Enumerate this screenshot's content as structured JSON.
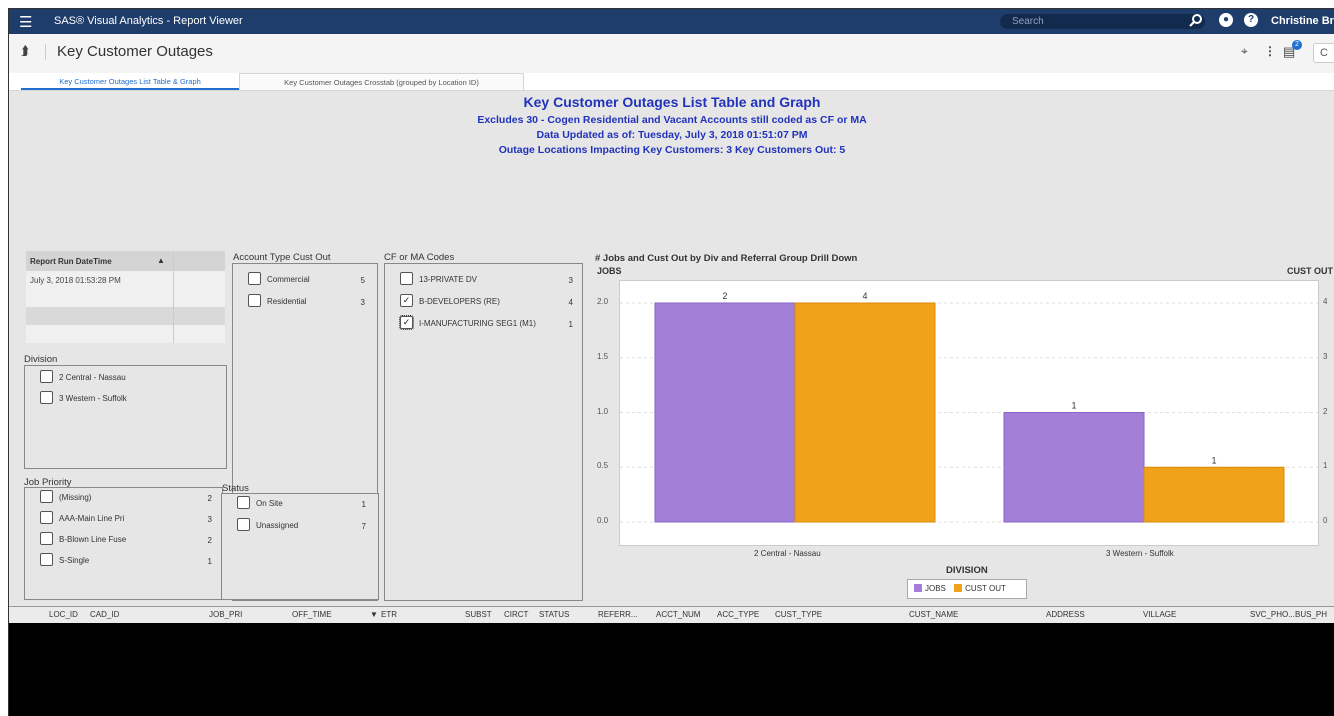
{
  "app": {
    "title": "SAS® Visual Analytics - Report Viewer",
    "search_placeholder": "Search",
    "user": "Christine Br"
  },
  "header": {
    "report_title": "Key Customer Outages",
    "badge": "2",
    "box_text": "C"
  },
  "tabs": [
    {
      "label": "Key Customer Outages List Table & Graph",
      "active": true
    },
    {
      "label": "Key Customer Outages Crosstab (grouped by Location ID)",
      "active": false
    }
  ],
  "report": {
    "title": "Key Customer Outages List Table and Graph",
    "line1": "Excludes 30 - Cogen Residential and Vacant Accounts still coded as CF or MA",
    "line2": "Data Updated as of: Tuesday, July 3, 2018 01:51:07 PM",
    "line3": "Outage Locations Impacting Key Customers:  3 Key Customers Out: 5"
  },
  "report_run": {
    "header": "Report Run DateTime",
    "value": "July 3, 2018 01:53:28 PM"
  },
  "division": {
    "label": "Division",
    "items": [
      {
        "label": "2 Central - Nassau"
      },
      {
        "label": "3 Western - Suffolk"
      }
    ]
  },
  "account_type": {
    "label": "Account Type Cust Out",
    "items": [
      {
        "label": "Commercial",
        "count": "5"
      },
      {
        "label": "Residential",
        "count": "3"
      }
    ]
  },
  "cf_ma": {
    "label": "CF or MA Codes",
    "items": [
      {
        "label": "13-PRIVATE DV",
        "count": "3",
        "checked": false
      },
      {
        "label": "B-DEVELOPERS (RE)",
        "count": "4",
        "checked": true
      },
      {
        "label": "I-MANUFACTURING SEG1 (M1)",
        "count": "1",
        "checked": true
      }
    ]
  },
  "job_priority": {
    "label": "Job Priority",
    "items": [
      {
        "label": "(Missing)",
        "count": "2"
      },
      {
        "label": "AAA-Main Line Pri",
        "count": "3"
      },
      {
        "label": "B-Blown Line Fuse",
        "count": "2"
      },
      {
        "label": "S-Single",
        "count": "1"
      }
    ]
  },
  "status": {
    "label": "Status",
    "items": [
      {
        "label": "On Site",
        "count": "1"
      },
      {
        "label": "Unassigned",
        "count": "7"
      }
    ]
  },
  "colors": {
    "jobs": "#a47fd8",
    "cust_out": "#f0a21b",
    "title_blue": "#2233bb",
    "topbar": "#1f3d6b"
  },
  "chart_data": {
    "type": "bar",
    "title": "# Jobs and Cust Out by Div and Referral Group Drill Down",
    "categories": [
      "2 Central - Nassau",
      "3 Western - Suffolk"
    ],
    "xlabel": "DIVISION",
    "ylabel": "JOBS",
    "y2label": "CUST OUT",
    "ylim": [
      0,
      2.0
    ],
    "y2lim": [
      0,
      4
    ],
    "yticks": [
      "0.0",
      "0.5",
      "1.0",
      "1.5",
      "2.0"
    ],
    "y2ticks": [
      "0",
      "1",
      "2",
      "3",
      "4"
    ],
    "series": [
      {
        "name": "JOBS",
        "axis": "left",
        "values": [
          2,
          1
        ],
        "labels": [
          "2",
          "1"
        ]
      },
      {
        "name": "CUST OUT",
        "axis": "right",
        "values": [
          4,
          1
        ],
        "labels": [
          "4",
          "1"
        ]
      }
    ],
    "legend": "bottom"
  },
  "table": {
    "columns": [
      "LOC_ID",
      "CAD_ID",
      "JOB_PRI",
      "OFF_TIME",
      "ETR",
      "SUBST",
      "CIRCT",
      "STATUS",
      "REFERR...",
      "ACCT_NUM",
      "ACC_TYPE",
      "CUST_TYPE",
      "CUST_NAME",
      "ADDRESS",
      "VILLAGE",
      "SVC_PHO...",
      "BUS_PH"
    ]
  }
}
